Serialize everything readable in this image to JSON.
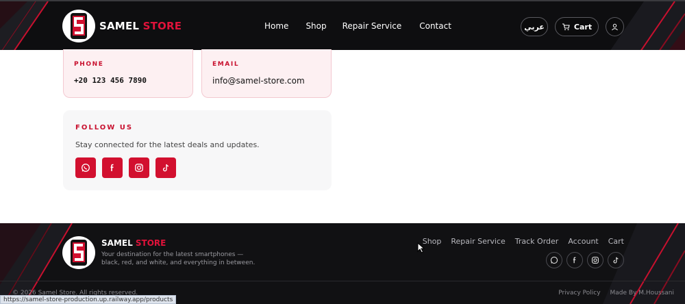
{
  "header": {
    "brand_main": "SAMEL",
    "brand_accent": "STORE",
    "nav": [
      "Home",
      "Shop",
      "Repair Service",
      "Contact"
    ],
    "lang_label": "عربي",
    "cart_label": "Cart"
  },
  "contact": {
    "phone_label": "PHONE",
    "phone_value": "+20 123 456 7890",
    "email_label": "EMAIL",
    "email_value": "info@samel-store.com"
  },
  "follow": {
    "title": "FOLLOW US",
    "description": "Stay connected for the latest deals and updates.",
    "icons": [
      "whatsapp-icon",
      "facebook-icon",
      "instagram-icon",
      "tiktok-icon"
    ]
  },
  "footer": {
    "brand_main": "SAMEL",
    "brand_accent": "STORE",
    "tagline": "Your destination for the latest smartphones — black, red, and white, and everything in between.",
    "links": [
      "Shop",
      "Repair Service",
      "Track Order",
      "Account",
      "Cart"
    ],
    "copyright": "© 2026 Samel Store. All rights reserved.",
    "privacy": "Privacy Policy",
    "made_by": "Made By M.Houssani"
  },
  "status_bar_url": "https://samel-store-production.up.railway.app/products",
  "colors": {
    "accent": "#d2102f",
    "dark": "#0e0e10",
    "card_bg": "#fdf0f2"
  }
}
